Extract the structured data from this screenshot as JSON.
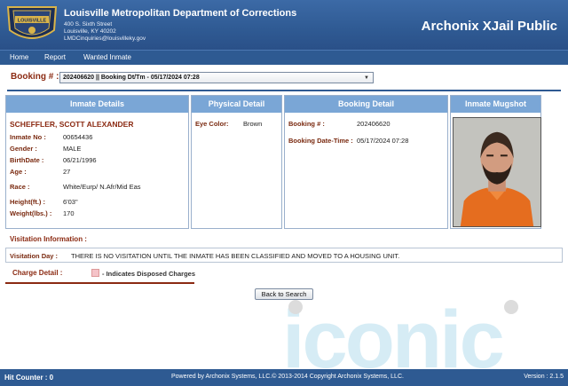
{
  "header": {
    "badge_text": "LOUISVILLE",
    "org_name": "Louisville Metropolitan Department of Corrections",
    "address_line1": "400 S. Sixth Street",
    "address_line2": "Louisville, KY 40202",
    "email": "LMDCinquiries@louisvilleky.gov",
    "app_title": "Archonix XJail Public"
  },
  "nav": {
    "items": [
      "Home",
      "Report",
      "Wanted Inmate"
    ]
  },
  "booking": {
    "label": "Booking # :",
    "selected": "202406620 || Booking Dt/Tm - 05/17/2024 07:28"
  },
  "inmate": {
    "header": "Inmate Details",
    "name": "SCHEFFLER, SCOTT ALEXANDER",
    "fields": [
      {
        "label": "Inmate No :",
        "value": "00654436"
      },
      {
        "label": "Gender :",
        "value": "MALE"
      },
      {
        "label": "BirthDate :",
        "value": "06/21/1996"
      },
      {
        "label": "Age :",
        "value": "27"
      },
      {
        "label": "Race :",
        "value": "White/Eurp/ N.Afr/Mid Eas"
      },
      {
        "label": "Height(ft.) :",
        "value": "6'03\""
      },
      {
        "label": "Weight(lbs.) :",
        "value": "170"
      }
    ]
  },
  "physical": {
    "header": "Physical Detail",
    "eye_label": "Eye Color:",
    "eye_value": "Brown"
  },
  "booking_detail": {
    "header": "Booking Detail",
    "booking_no_label": "Booking # :",
    "booking_no_value": "202406620",
    "datetime_label": "Booking Date-Time :",
    "datetime_value": "05/17/2024 07:28"
  },
  "mugshot": {
    "header": "Inmate Mugshot"
  },
  "visitation": {
    "title": "Visitation Information :",
    "day_label": "Visitation Day :",
    "day_value": "THERE IS NO VISITATION UNTIL THE INMATE HAS BEEN CLASSIFIED AND MOVED TO A HOUSING UNIT."
  },
  "charges": {
    "title": "Charge Detail :",
    "legend": "- Indicates Disposed Charges"
  },
  "back_button": "Back to Search",
  "watermark_text": "iconic",
  "footer": {
    "hit_counter": "Hit Counter : 0",
    "powered": "Powered by Archonix Systems, LLC.© 2013-2014 Copyright Archonix Systems, LLC.",
    "version": "Version : 2.1.5"
  },
  "colors": {
    "header_blue": "#2e5a92",
    "panel_header": "#7aa6d6",
    "label_brown": "#7a2a10",
    "disposed_swatch": "#f5c3c8"
  }
}
